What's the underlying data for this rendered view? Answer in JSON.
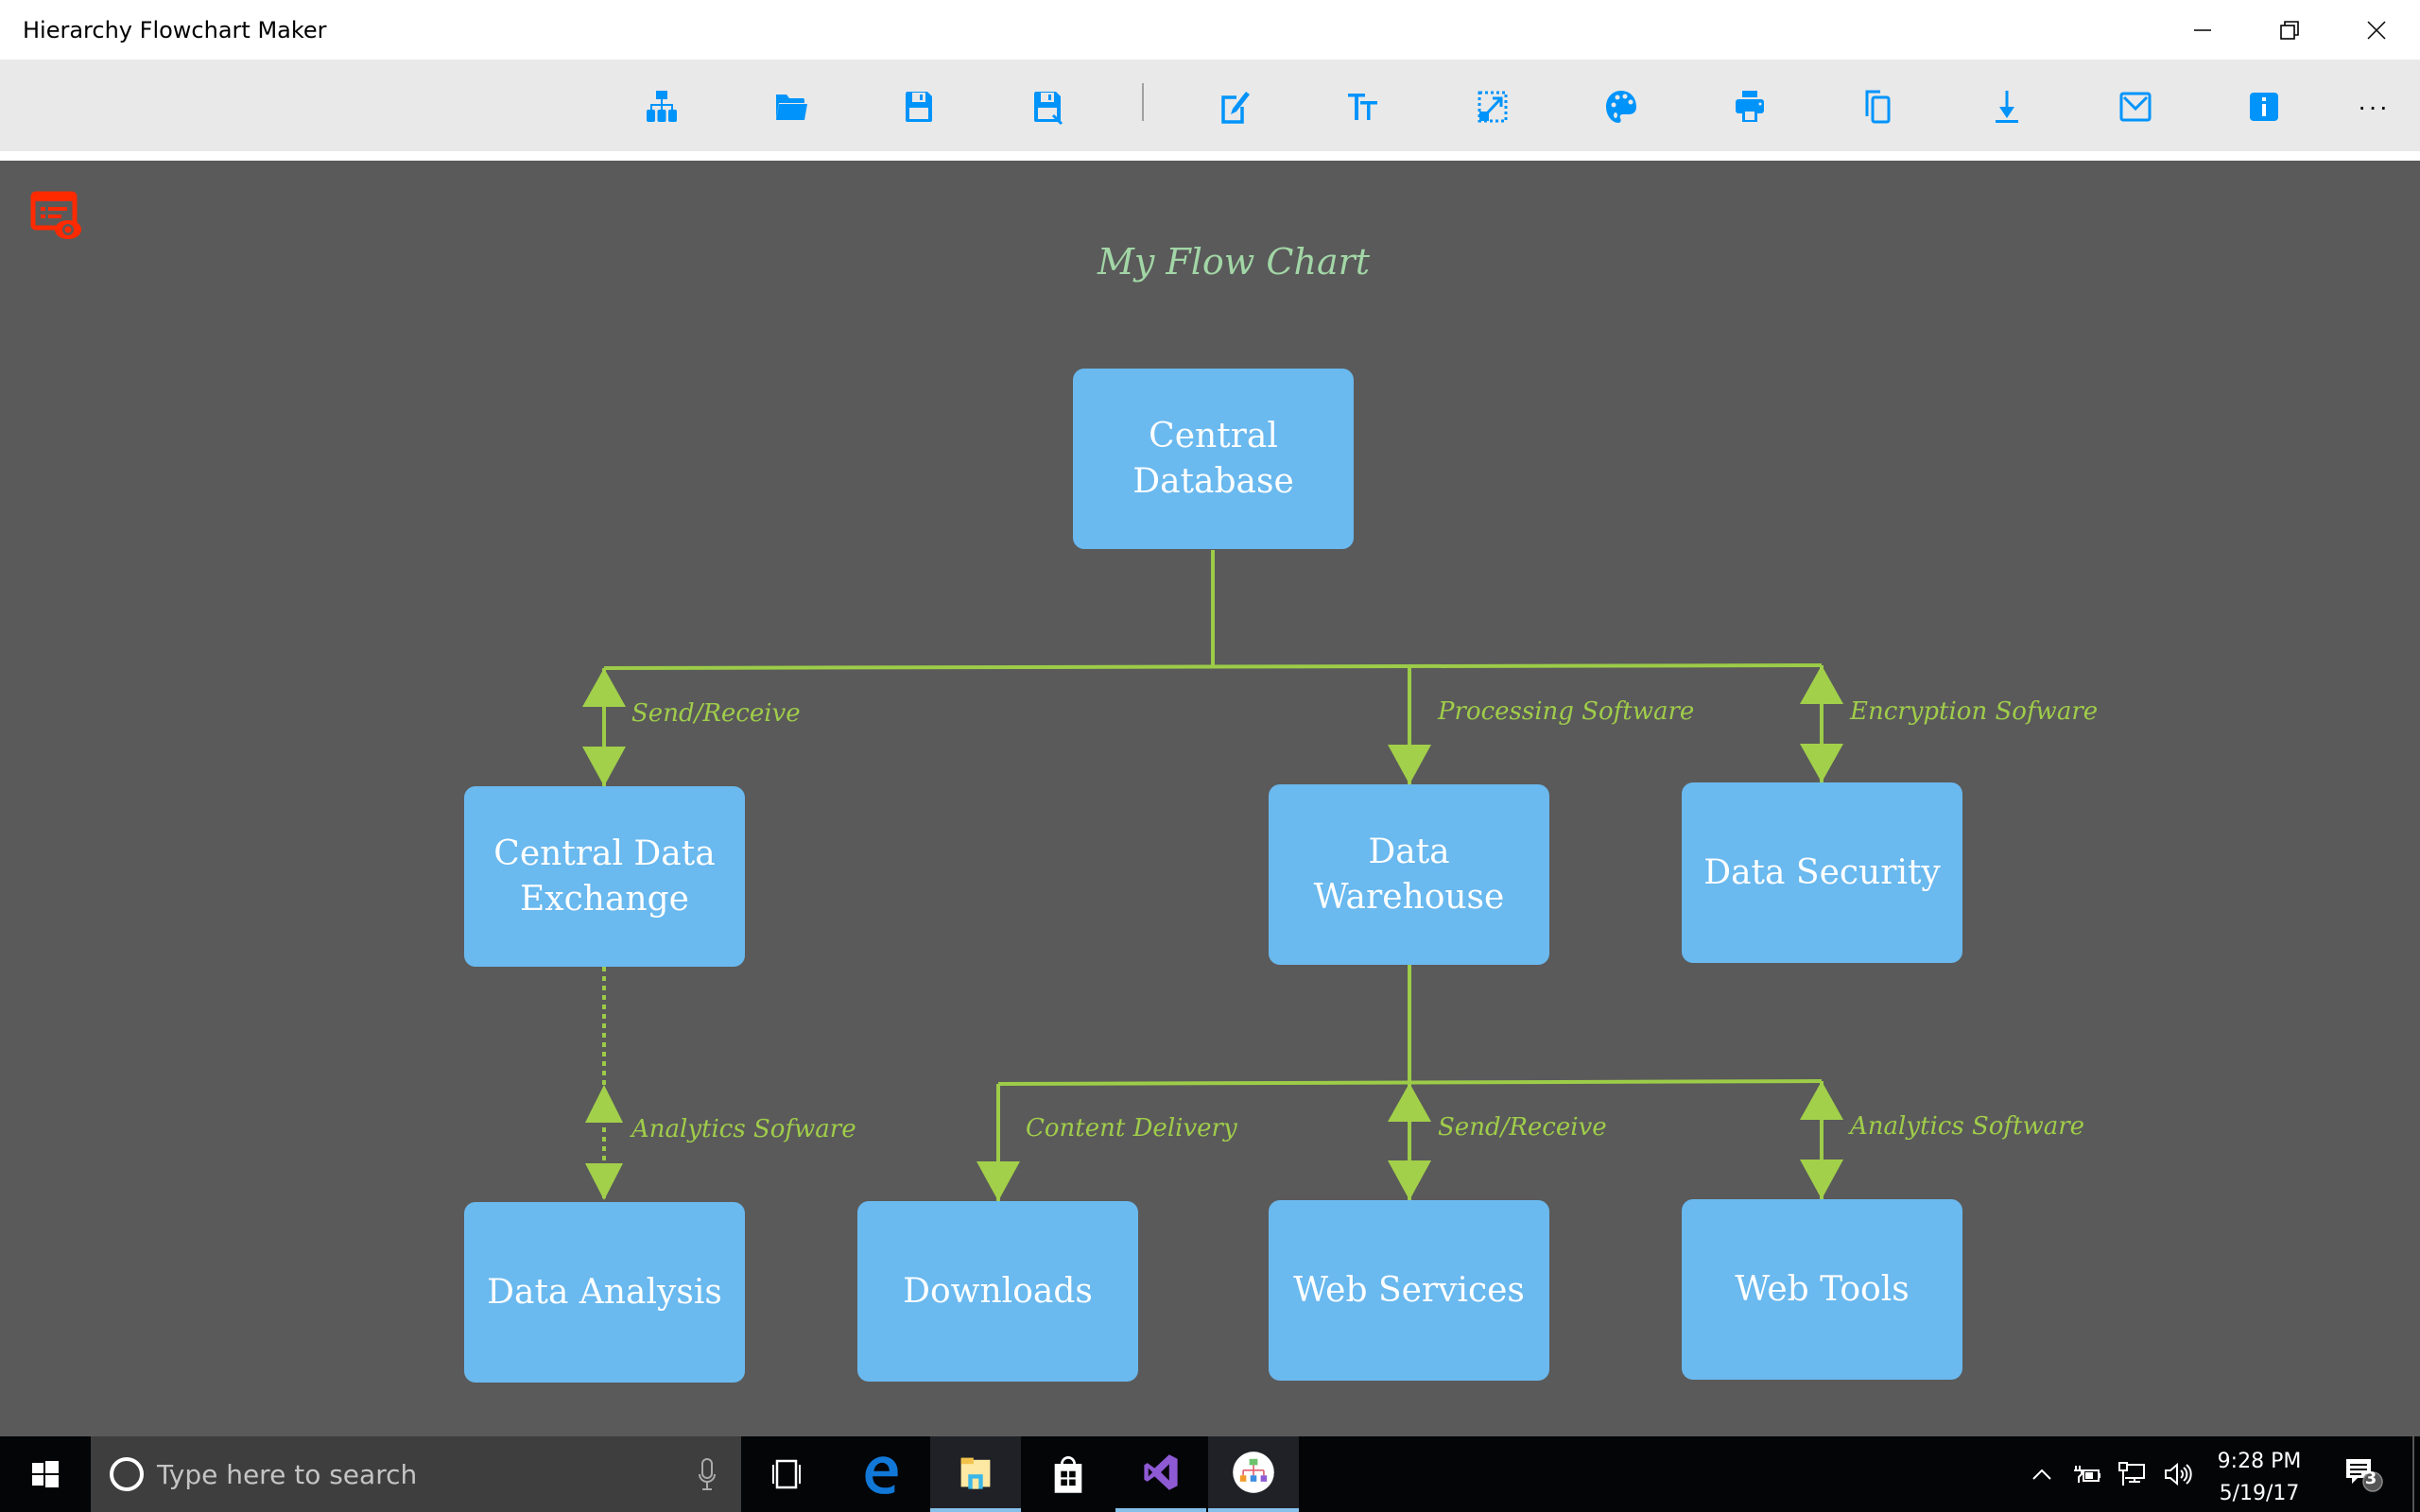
{
  "window": {
    "title": "Hierarchy Flowchart Maker",
    "controls": [
      "minimize",
      "restore",
      "close"
    ]
  },
  "toolbar": {
    "buttons": [
      {
        "id": "new-chart",
        "icon": "hierarchy-icon"
      },
      {
        "id": "open",
        "icon": "folder-open-icon"
      },
      {
        "id": "save",
        "icon": "save-icon"
      },
      {
        "id": "save-as",
        "icon": "save-as-icon"
      },
      {
        "id": "edit",
        "icon": "edit-icon"
      },
      {
        "id": "text-format",
        "icon": "text-size-icon"
      },
      {
        "id": "resize",
        "icon": "resize-icon"
      },
      {
        "id": "theme",
        "icon": "palette-icon"
      },
      {
        "id": "print",
        "icon": "print-icon"
      },
      {
        "id": "copy",
        "icon": "copy-icon"
      },
      {
        "id": "download",
        "icon": "download-icon"
      },
      {
        "id": "email",
        "icon": "mail-icon"
      },
      {
        "id": "info",
        "icon": "info-icon"
      }
    ],
    "more_label": "···",
    "accent": "#0094fb"
  },
  "canvas": {
    "background": "#5a5a5a",
    "preview_icon": "preview-eye-icon",
    "preview_icon_color": "#ff2a00"
  },
  "flowchart": {
    "title": "My Flow Chart",
    "title_color": "#a2d6a6",
    "node_color": "#6ab9ef",
    "edge_color": "#9ccc48",
    "nodes": [
      {
        "id": "central-database",
        "label": "Central Database"
      },
      {
        "id": "central-data-exchange",
        "label": "Central Data Exchange"
      },
      {
        "id": "data-warehouse",
        "label": "Data Warehouse"
      },
      {
        "id": "data-security",
        "label": "Data Security"
      },
      {
        "id": "data-analysis",
        "label": "Data Analysis"
      },
      {
        "id": "downloads",
        "label": "Downloads"
      },
      {
        "id": "web-services",
        "label": "Web Services"
      },
      {
        "id": "web-tools",
        "label": "Web Tools"
      }
    ],
    "edges": [
      {
        "from": "central-database",
        "to": "central-data-exchange",
        "label": "Send/Receive",
        "style": "solid",
        "arrows": "both"
      },
      {
        "from": "central-database",
        "to": "data-warehouse",
        "label": "Processing Software",
        "style": "solid",
        "arrows": "end"
      },
      {
        "from": "central-database",
        "to": "data-security",
        "label": "Encryption Sofware",
        "style": "solid",
        "arrows": "both"
      },
      {
        "from": "central-data-exchange",
        "to": "data-analysis",
        "label": "Analytics Sofware",
        "style": "dotted",
        "arrows": "both"
      },
      {
        "from": "data-warehouse",
        "to": "downloads",
        "label": "Content Delivery",
        "style": "solid",
        "arrows": "end"
      },
      {
        "from": "data-warehouse",
        "to": "web-services",
        "label": "Send/Receive",
        "style": "solid",
        "arrows": "both"
      },
      {
        "from": "data-warehouse",
        "to": "web-tools",
        "label": "Analytics Software",
        "style": "solid",
        "arrows": "both"
      }
    ]
  },
  "taskbar": {
    "search_placeholder": "Type here to search",
    "apps": [
      {
        "name": "task-view",
        "active": false
      },
      {
        "name": "edge",
        "active": false
      },
      {
        "name": "file-explorer",
        "active": true
      },
      {
        "name": "store",
        "active": false
      },
      {
        "name": "visual-studio",
        "active": false
      },
      {
        "name": "hierarchy-flowchart-maker",
        "active": true
      }
    ],
    "time": "9:28 PM",
    "date": "5/19/17",
    "notification_count": "3"
  }
}
